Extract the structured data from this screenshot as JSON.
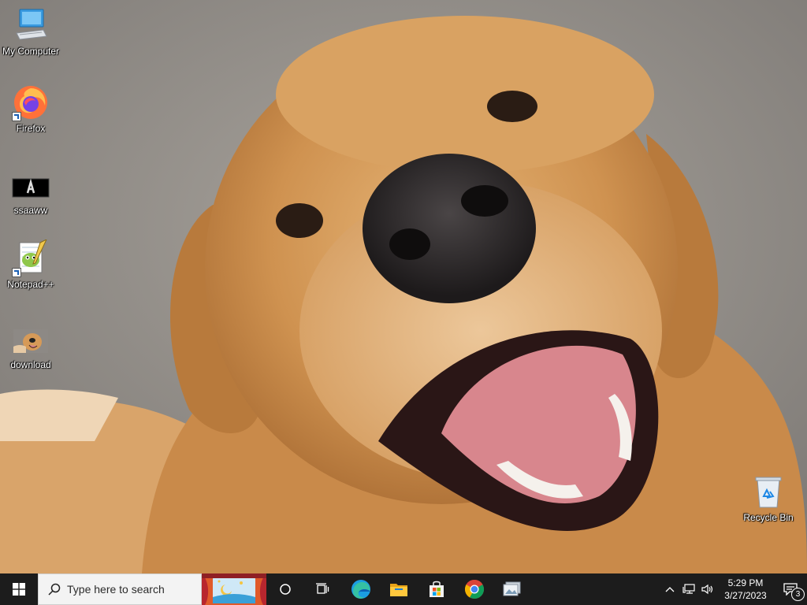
{
  "desktop": {
    "wallpaper": "golden-retriever-photo",
    "icons": [
      {
        "label": "My Computer",
        "icon": "computer-icon"
      },
      {
        "label": "Firefox",
        "icon": "firefox-icon"
      },
      {
        "label": "ssaaww",
        "icon": "ssaaww-image-icon"
      },
      {
        "label": "Notepad++",
        "icon": "notepadpp-icon"
      },
      {
        "label": "download",
        "icon": "dog-image-thumbnail-icon"
      },
      {
        "label": "Recycle Bin",
        "icon": "recycle-bin-icon"
      }
    ]
  },
  "taskbar": {
    "search_placeholder": "Type here to search",
    "pinned": [
      "cortana-icon",
      "task-view-icon",
      "edge-icon",
      "file-explorer-icon",
      "microsoft-store-icon",
      "chrome-icon",
      "photos-icon"
    ],
    "clock_time": "5:29 PM",
    "clock_date": "3/27/2023",
    "notification_count": "3"
  },
  "colors": {
    "taskbar": "#1c1c1c",
    "search_bg": "#f3f3f3",
    "accent_blue": "#0078d4"
  }
}
